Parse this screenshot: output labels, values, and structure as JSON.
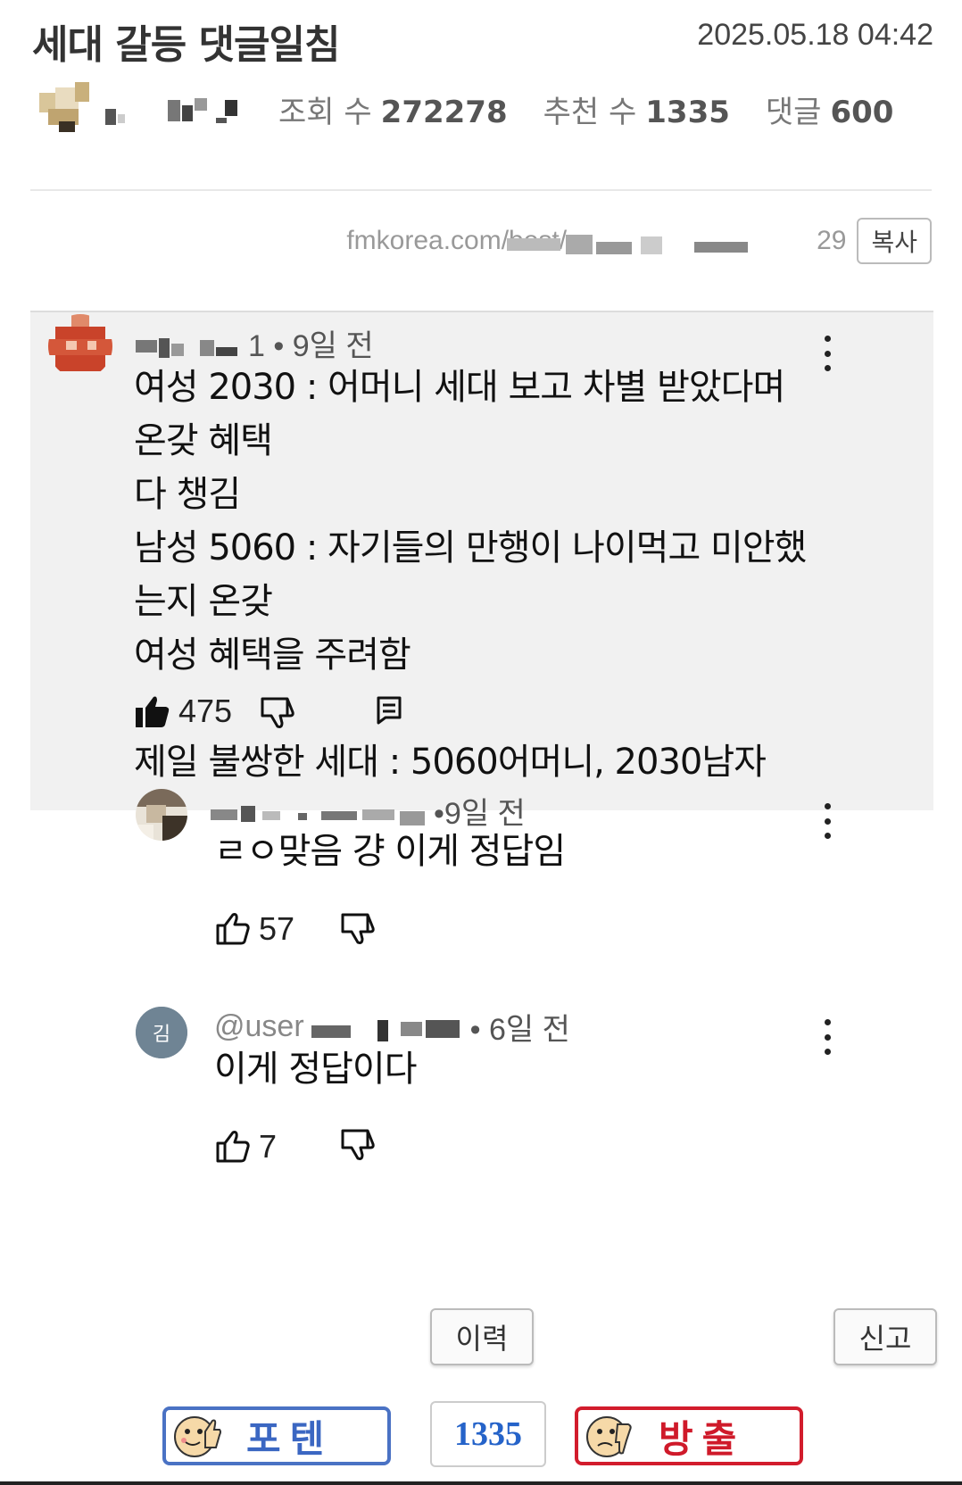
{
  "post": {
    "title": "세대 갈등 댓글일침",
    "date": "2025.05.18 04:42",
    "views_label": "조회 수",
    "views": "272278",
    "recommend_label": "추천 수",
    "recommend": "1335",
    "comments_label": "댓글",
    "comments": "600",
    "url_prefix": "fmkorea.com/best/",
    "url_suffix": "29",
    "copy_label": "복사"
  },
  "comments": [
    {
      "meta_tail": "1 • 9일 전",
      "text": "여성 2030 : 어머니 세대 보고 차별 받았다며 온갖 혜택\n다 챙김\n남성 5060 : 자기들의 만행이 나이먹고 미안했는지 온갖\n여성 혜택을 주려함\n\n제일 불쌍한 세대 : 5060어머니, 2030남자",
      "likes": "475",
      "avatar_color": "#c9432a"
    },
    {
      "meta_tail": "•9일 전",
      "text": "ㄹㅇ맞음 걍 이게 정답임",
      "likes": "57"
    },
    {
      "meta_prefix": "@user",
      "meta_tail": "• 6일 전",
      "text": "이게 정답이다",
      "likes": "7",
      "avatar_letter": "김"
    }
  ],
  "footer": {
    "history_label": "이력",
    "report_label": "신고",
    "upvote_label": "포텐",
    "vote_count": "1335",
    "downvote_label": "방출"
  },
  "colors": {
    "upvote": "#3b67c2",
    "downvote": "#cf1a2a",
    "count": "#2563c9"
  }
}
